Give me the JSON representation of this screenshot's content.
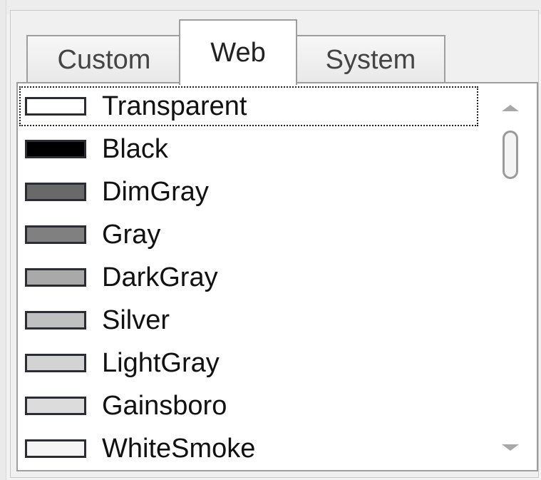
{
  "tabs": [
    {
      "label": "Custom"
    },
    {
      "label": "Web"
    },
    {
      "label": "System"
    }
  ],
  "active_tab": "Web",
  "colors": [
    {
      "label": "Transparent",
      "swatch": "#ffffff",
      "selected": true
    },
    {
      "label": "Black",
      "swatch": "#000000"
    },
    {
      "label": "DimGray",
      "swatch": "#696969"
    },
    {
      "label": "Gray",
      "swatch": "#808080"
    },
    {
      "label": "DarkGray",
      "swatch": "#a9a9a9"
    },
    {
      "label": "Silver",
      "swatch": "#c0c0c0"
    },
    {
      "label": "LightGray",
      "swatch": "#d3d3d3"
    },
    {
      "label": "Gainsboro",
      "swatch": "#dcdcdc"
    },
    {
      "label": "WhiteSmoke",
      "swatch": "#f5f5f5"
    }
  ],
  "scrollbar": {
    "up_icon": "chevron-up-icon",
    "down_icon": "chevron-down-icon"
  }
}
